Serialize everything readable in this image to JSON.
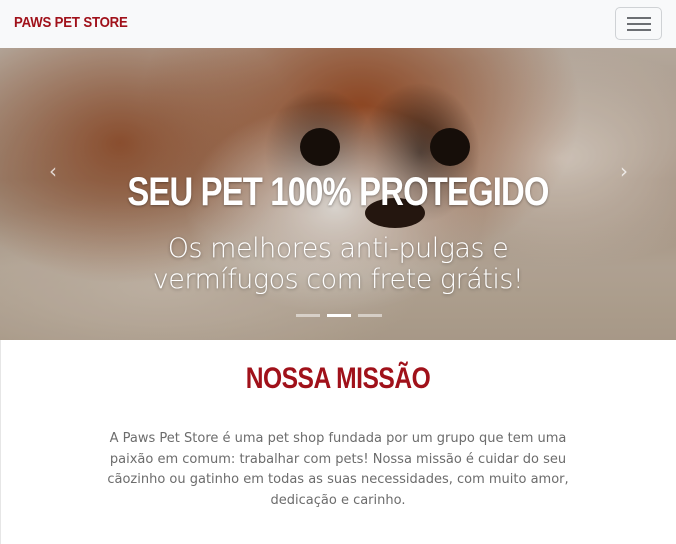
{
  "navbar": {
    "brand": "PAWS PET STORE",
    "toggler_icon": "hamburger-menu-icon"
  },
  "carousel": {
    "title": "SEU PET 100% PROTEGIDO",
    "text": "Os melhores anti-pulgas e vermífugos com frete grátis!",
    "prev_icon": "chevron-left-icon",
    "next_icon": "chevron-right-icon",
    "prev_glyph": "‹",
    "next_glyph": "›",
    "slide_count": 3,
    "active_slide": 2
  },
  "mission": {
    "title": "NOSSA MISSÃO",
    "text": "A Paws Pet Store é uma pet shop fundada por um grupo que tem uma paixão em comum: trabalhar com pets! Nossa missão é cuidar do seu cãozinho ou gatinho em todas as suas necessidades, com muito amor, dedicação e carinho."
  },
  "colors": {
    "brand": "#a0111a",
    "navbar_bg": "#f8f9fa",
    "body_text": "#6c6c6c"
  }
}
